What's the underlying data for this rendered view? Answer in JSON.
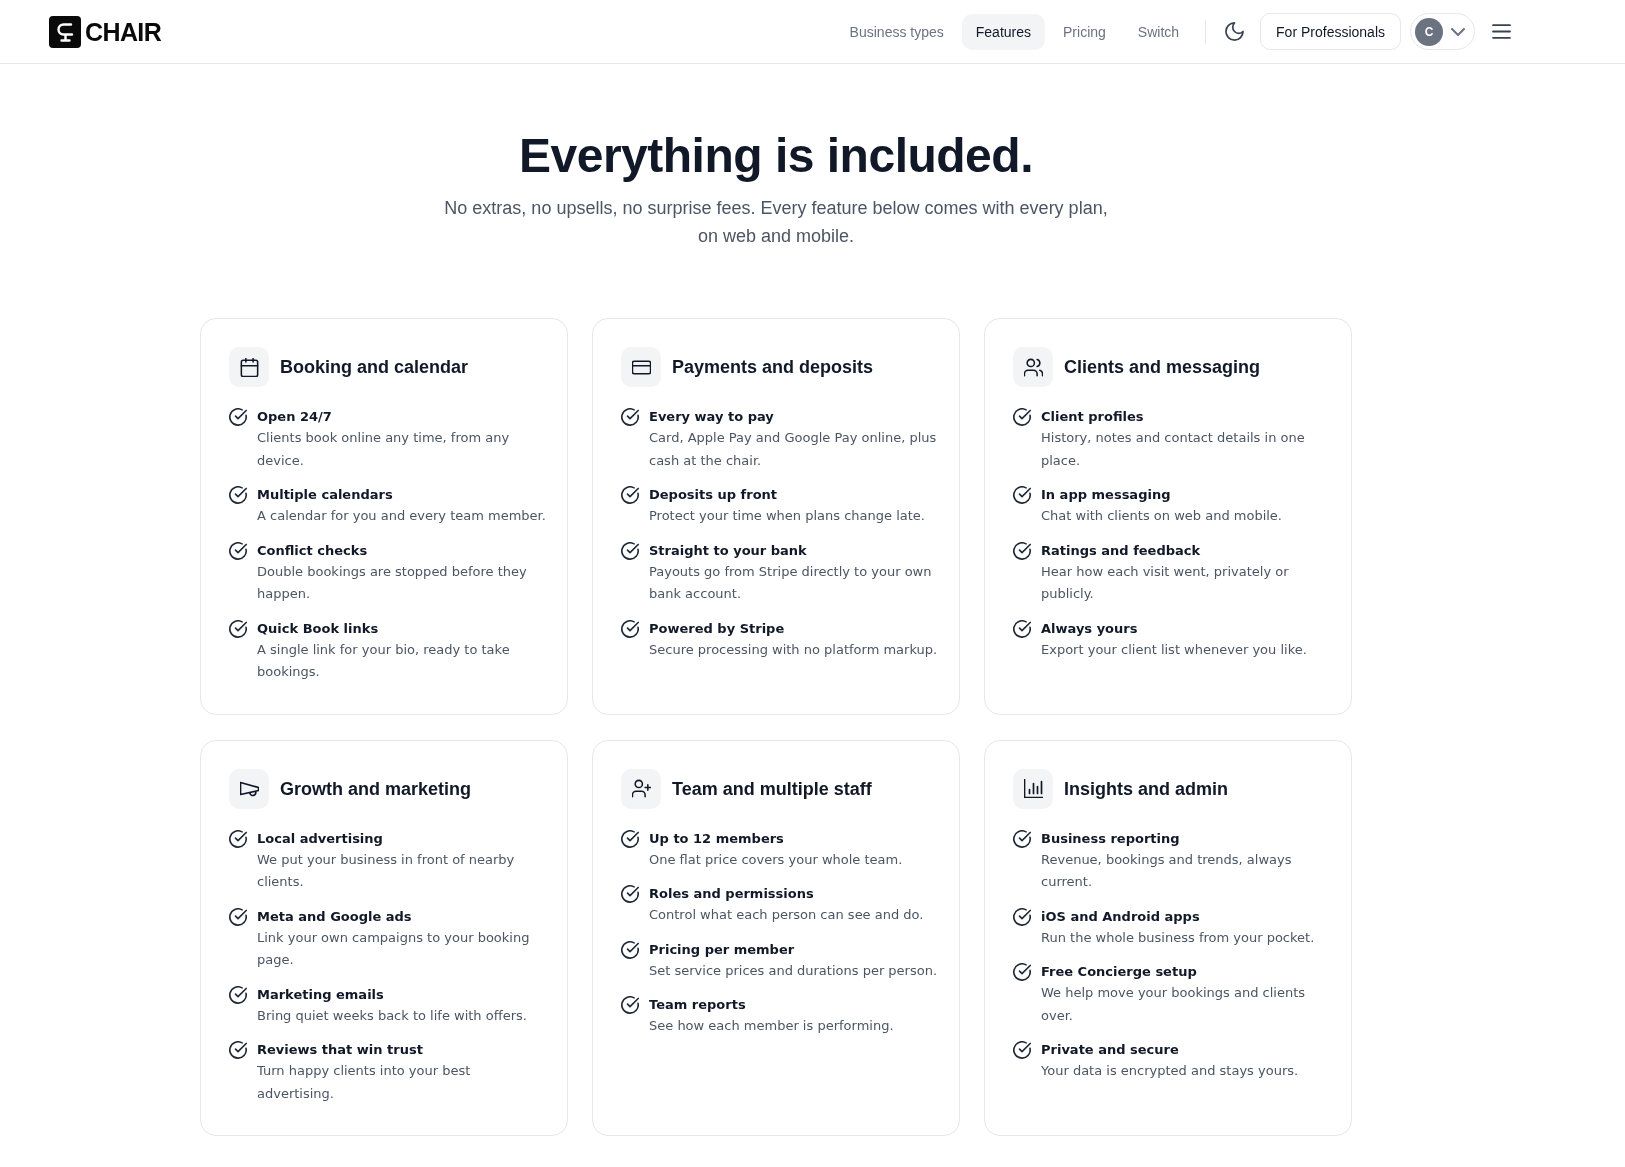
{
  "header": {
    "logo": "CHAIR",
    "nav": [
      {
        "label": "Business types",
        "selected": false
      },
      {
        "label": "Features",
        "selected": true
      },
      {
        "label": "Pricing",
        "selected": false
      },
      {
        "label": "Switch",
        "selected": false
      }
    ],
    "professionals_button": "For Professionals",
    "avatar_initial": "C"
  },
  "hero": {
    "title": "Everything is included.",
    "subtitle": "No extras, no upsells, no surprise fees. Every feature below comes with every plan, on web and mobile."
  },
  "cards": [
    {
      "title": "Booking and calendar",
      "features": [
        {
          "title": "Open 24/7",
          "description": "Clients book online any time, from any device."
        },
        {
          "title": "Multiple calendars",
          "description": "A calendar for you and every team member."
        },
        {
          "title": "Conflict checks",
          "description": "Double bookings are stopped before they happen."
        },
        {
          "title": "Quick Book links",
          "description": "A single link for your bio, ready to take bookings."
        }
      ]
    },
    {
      "title": "Payments and deposits",
      "features": [
        {
          "title": "Every way to pay",
          "description": "Card, Apple Pay and Google Pay online, plus cash at the chair."
        },
        {
          "title": "Deposits up front",
          "description": "Protect your time when plans change late."
        },
        {
          "title": "Straight to your bank",
          "description": "Payouts go from Stripe directly to your own bank account."
        },
        {
          "title": "Powered by Stripe",
          "description": "Secure processing with no platform markup."
        }
      ]
    },
    {
      "title": "Clients and messaging",
      "features": [
        {
          "title": "Client profiles",
          "description": "History, notes and contact details in one place."
        },
        {
          "title": "In app messaging",
          "description": "Chat with clients on web and mobile."
        },
        {
          "title": "Ratings and feedback",
          "description": "Hear how each visit went, privately or publicly."
        },
        {
          "title": "Always yours",
          "description": "Export your client list whenever you like."
        }
      ]
    },
    {
      "title": "Growth and marketing",
      "features": [
        {
          "title": "Local advertising",
          "description": "We put your business in front of nearby clients."
        },
        {
          "title": "Meta and Google ads",
          "description": "Link your own campaigns to your booking page."
        },
        {
          "title": "Marketing emails",
          "description": "Bring quiet weeks back to life with offers."
        },
        {
          "title": "Reviews that win trust",
          "description": "Turn happy clients into your best advertising."
        }
      ]
    },
    {
      "title": "Team and multiple staff",
      "features": [
        {
          "title": "Up to 12 members",
          "description": "One flat price covers your whole team."
        },
        {
          "title": "Roles and permissions",
          "description": "Control what each person can see and do."
        },
        {
          "title": "Pricing per member",
          "description": "Set service prices and durations per person."
        },
        {
          "title": "Team reports",
          "description": "See how each member is performing."
        }
      ]
    },
    {
      "title": "Insights and admin",
      "features": [
        {
          "title": "Business reporting",
          "description": "Revenue, bookings and trends, always current."
        },
        {
          "title": "iOS and Android apps",
          "description": "Run the whole business from your pocket."
        },
        {
          "title": "Free Concierge setup",
          "description": "We help move your bookings and clients over."
        },
        {
          "title": "Private and secure",
          "description": "Your data is encrypted and stays yours."
        }
      ]
    }
  ]
}
